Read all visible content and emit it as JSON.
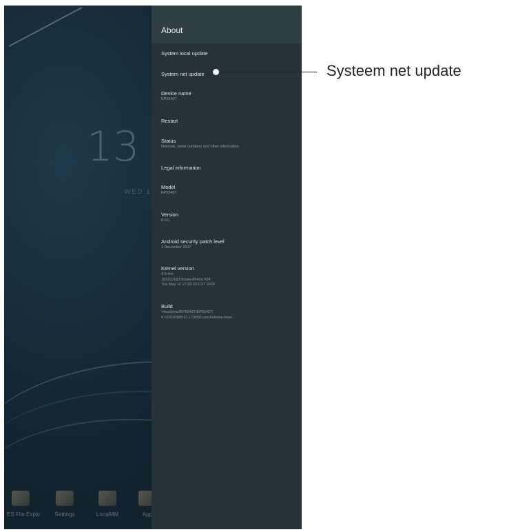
{
  "home": {
    "clock": "13",
    "date": "WED 1",
    "dock_apps": [
      "ES File Explo",
      "Settings",
      "LocalMM",
      "App"
    ]
  },
  "panel": {
    "title": "About",
    "items": [
      {
        "title": "System local update"
      },
      {
        "title": "System net update"
      },
      {
        "title": "Device name",
        "sub": [
          "EP5540T"
        ]
      },
      {
        "title": "Restart"
      },
      {
        "title": "Status",
        "sub": [
          "Network, serial numbers and other information"
        ]
      },
      {
        "title": "Legal information"
      },
      {
        "title": "Model",
        "sub": [
          "EP5540T"
        ]
      },
      {
        "title": "Version",
        "sub": [
          "8.0.0"
        ]
      },
      {
        "title": "Android security patch level",
        "sub": [
          "1 December 2017"
        ]
      },
      {
        "title": "Kernel version",
        "sub": [
          "4.9.44+",
          "1811110@Ubuntu-iPrima #24",
          "Tue May 12 17:32:32 CST 2020"
        ]
      },
      {
        "title": "Build",
        "sub": [
          "ViewSonic/EP5542T/EP5542T:",
          "8.0.0/20200512.173050:user/release-keys"
        ]
      }
    ]
  },
  "callout": {
    "label": "Systeem net update"
  }
}
